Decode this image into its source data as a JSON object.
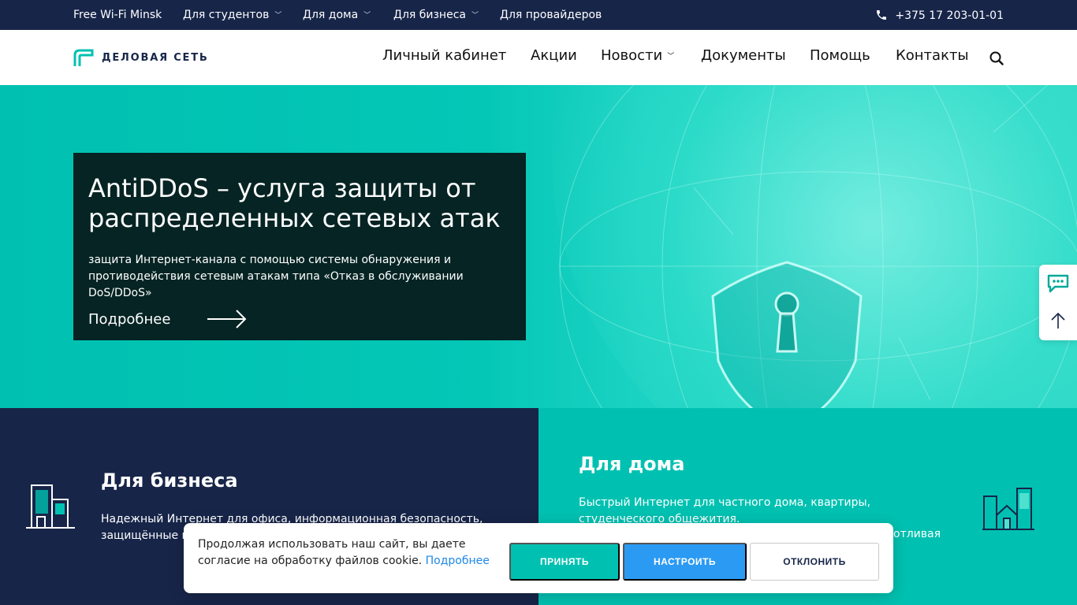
{
  "topbar": {
    "items": [
      {
        "label": "Free Wi-Fi Minsk",
        "dropdown": false
      },
      {
        "label": "Для студентов",
        "dropdown": true
      },
      {
        "label": "Для дома",
        "dropdown": true
      },
      {
        "label": "Для бизнеса",
        "dropdown": true
      },
      {
        "label": "Для провайдеров",
        "dropdown": false
      }
    ],
    "phone": "+375 17 203-01-01"
  },
  "header": {
    "logo_text": "ДЕЛОВАЯ СЕТЬ",
    "nav": [
      {
        "label": "Личный кабинет",
        "dropdown": false
      },
      {
        "label": "Акции",
        "dropdown": false
      },
      {
        "label": "Новости",
        "dropdown": true
      },
      {
        "label": "Документы",
        "dropdown": false
      },
      {
        "label": "Помощь",
        "dropdown": false
      },
      {
        "label": "Контакты",
        "dropdown": false
      }
    ]
  },
  "hero": {
    "title": "AntiDDoS – услуга защиты от распределенных сетевых атак",
    "description": "защита Интернет-канала с помощью системы обнаружения и противодействия сетевым атакам типа «Отказ в обслуживании DoS/DDoS»",
    "more_label": "Подробнее"
  },
  "business": {
    "title": "Для бизнеса",
    "description": "Надежный Интернет для офиса, информационная безопасность, защищённые ко"
  },
  "home": {
    "title": "Для дома",
    "description": "Быстрый Интернет для частного дома, квартиры, студенческого общежития.",
    "description_tail": "отливая"
  },
  "cookie": {
    "text": "Продолжая использовать наш сайт, вы даете согласие на обработку файлов cookie.",
    "link": "Подробнее",
    "accept": "ПРИНЯТЬ",
    "configure": "НАСТРОИТЬ",
    "decline": "ОТКЛОНИТЬ"
  },
  "colors": {
    "navy": "#172549",
    "teal": "#00c1b1",
    "blue": "#2b9af3"
  }
}
